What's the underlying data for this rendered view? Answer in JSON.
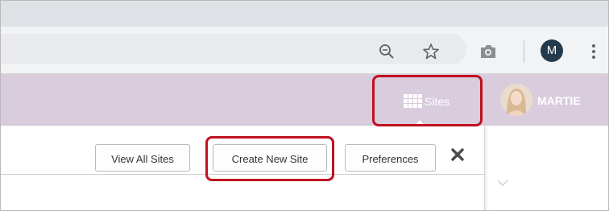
{
  "browser": {
    "profile_initial": "M",
    "icons": [
      "zoom-out-icon",
      "star-icon",
      "camera-icon",
      "more-vert-icon"
    ]
  },
  "appbar": {
    "sites_label": "Sites",
    "user_name": "MARTIE"
  },
  "sites_menu": {
    "view_all_label": "View All Sites",
    "create_label": "Create New Site",
    "preferences_label": "Preferences"
  },
  "colors": {
    "appbar_bg": "#d8ccdd",
    "highlight": "#c0111f",
    "avatar_bg": "#243a4d"
  }
}
